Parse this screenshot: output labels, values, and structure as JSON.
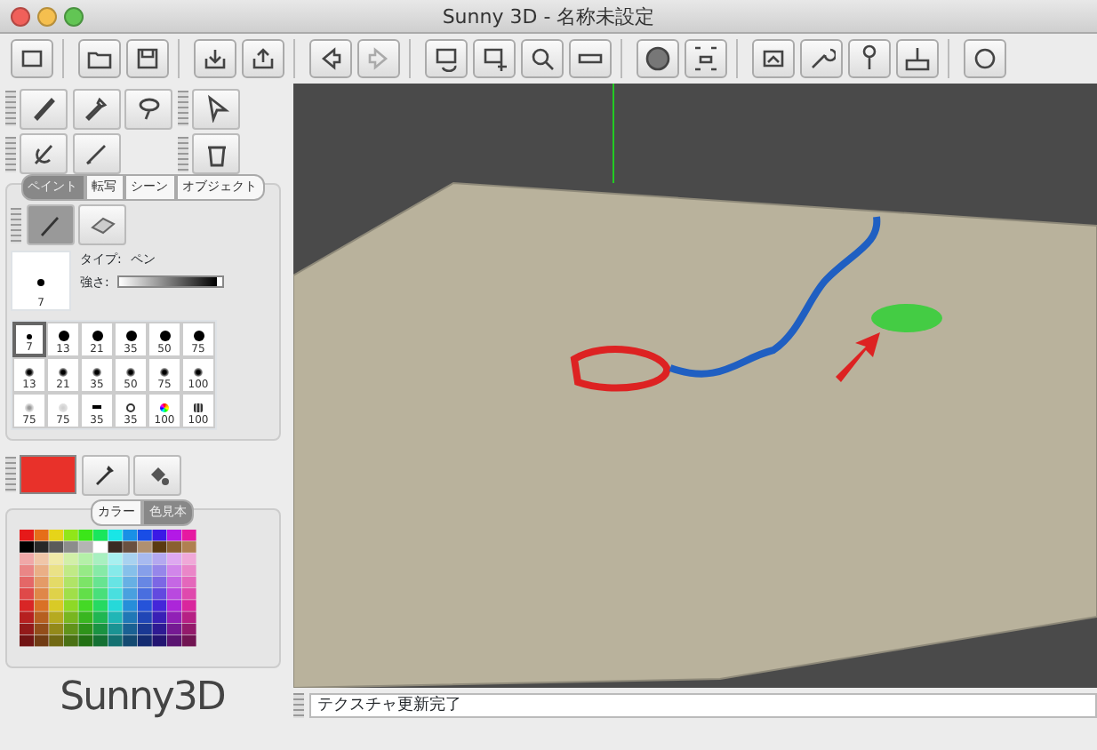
{
  "window": {
    "title": "Sunny 3D - 名称未設定"
  },
  "paint_tabs": [
    {
      "label": "ペイント",
      "selected": true
    },
    {
      "label": "転写",
      "selected": false
    },
    {
      "label": "シーン",
      "selected": false
    },
    {
      "label": "オブジェクト",
      "selected": false
    }
  ],
  "brush": {
    "size": "7",
    "type_label": "タイプ:",
    "type_value": "ペン",
    "strength_label": "強さ:",
    "strength": {
      "level": 0.95
    }
  },
  "brushes": [
    {
      "kind": "solid_small",
      "size": "7",
      "selected": true
    },
    {
      "kind": "solid",
      "size": "13",
      "selected": false
    },
    {
      "kind": "solid",
      "size": "21",
      "selected": false
    },
    {
      "kind": "solid",
      "size": "35",
      "selected": false
    },
    {
      "kind": "solid",
      "size": "50",
      "selected": false
    },
    {
      "kind": "solid",
      "size": "75",
      "selected": false
    },
    {
      "kind": "soft",
      "size": "13",
      "selected": false
    },
    {
      "kind": "soft",
      "size": "21",
      "selected": false
    },
    {
      "kind": "soft",
      "size": "35",
      "selected": false
    },
    {
      "kind": "soft",
      "size": "50",
      "selected": false
    },
    {
      "kind": "soft",
      "size": "75",
      "selected": false
    },
    {
      "kind": "soft",
      "size": "100",
      "selected": false
    },
    {
      "kind": "speckle",
      "size": "75",
      "selected": false
    },
    {
      "kind": "faint",
      "size": "75",
      "selected": false
    },
    {
      "kind": "bar",
      "size": "35",
      "selected": false
    },
    {
      "kind": "ring",
      "size": "35",
      "selected": false
    },
    {
      "kind": "rainbow",
      "size": "100",
      "selected": false
    },
    {
      "kind": "texture",
      "size": "100",
      "selected": false
    }
  ],
  "current_color": {
    "color": "#e8312a"
  },
  "color_tabs": [
    {
      "label": "カラー",
      "selected": false
    },
    {
      "label": "色見本",
      "selected": true
    }
  ],
  "logo": "Sunny3D",
  "status": "テクスチャ更新完了"
}
